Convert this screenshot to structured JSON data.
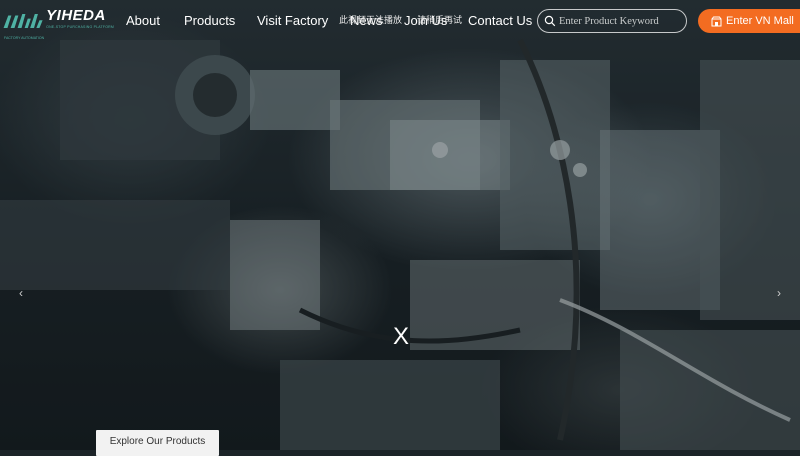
{
  "brand": {
    "name": "YIHEDA",
    "tagline": "ONE-STOP PURCHASING PLATFORM",
    "subline": "FACTORY AUTOMATION"
  },
  "nav": {
    "items": [
      {
        "label": "About"
      },
      {
        "label": "Products"
      },
      {
        "label": "Visit Factory"
      },
      {
        "label": "News"
      },
      {
        "label": "Join Us"
      },
      {
        "label": "Contact Us"
      }
    ]
  },
  "video_overlay": {
    "line1": "此视频无法播放",
    "line2": "请稍后再试"
  },
  "search": {
    "placeholder": "Enter Product Keyword",
    "value": "",
    "icon": "search-icon"
  },
  "mall_button": {
    "label": "Enter VN Mall",
    "icon": "shop-icon"
  },
  "carousel": {
    "prev_icon": "‹",
    "next_icon": "›",
    "close_label": "X"
  },
  "cta": {
    "label": "Explore Our Products"
  },
  "colors": {
    "accent": "#f36c21",
    "brand_teal": "#4fb2a4",
    "header_text": "#ffffff"
  }
}
